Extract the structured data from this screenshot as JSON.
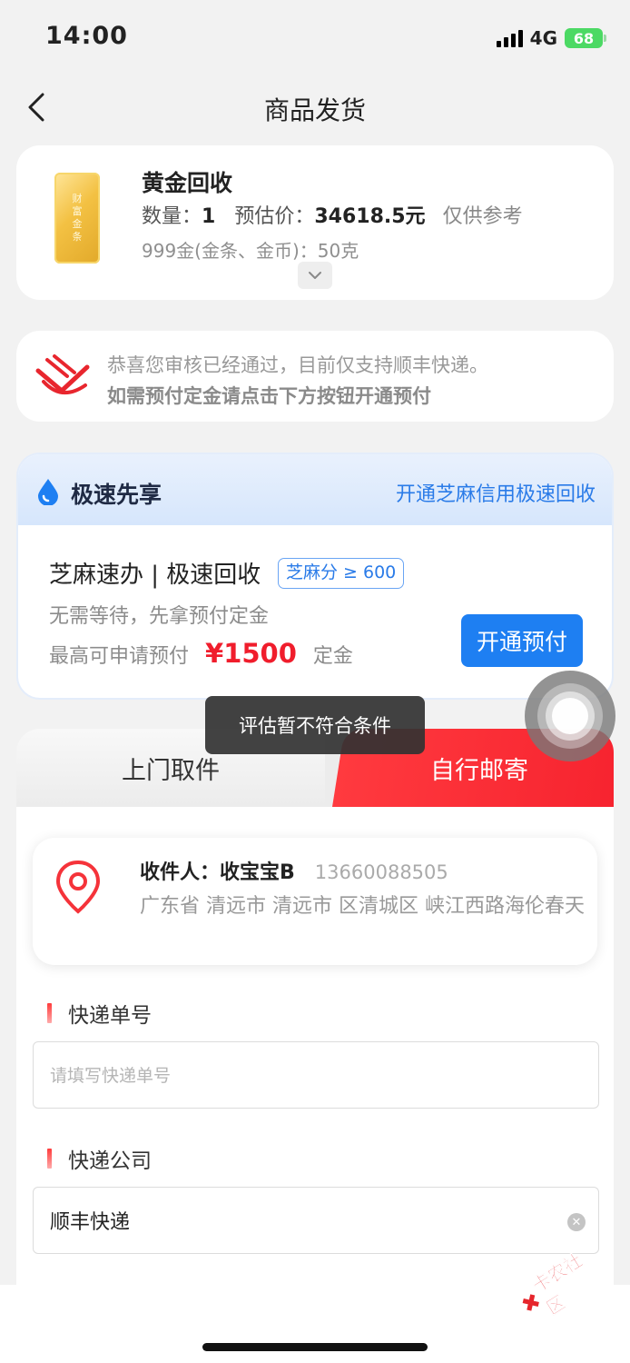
{
  "status_bar": {
    "time": "14:00",
    "network": "4G",
    "battery": "68"
  },
  "nav": {
    "title": "商品发货"
  },
  "product": {
    "title": "黄金回收",
    "quantity_label": "数量：",
    "quantity": "1",
    "price_label": "预估价：",
    "price": "34618.5元",
    "price_note": "仅供参考",
    "spec": "999金(金条、金币)：50克",
    "image_text": [
      "财",
      "富",
      "金",
      "条"
    ]
  },
  "notice": {
    "line1": "恭喜您审核已经通过，目前仅支持顺丰快递。",
    "line2": "如需预付定金请点击下方按钮开通预付"
  },
  "speed": {
    "title": "极速先享",
    "link": "开通芝麻信用极速回收",
    "product_title": "芝麻速办 | 极速回收",
    "badge": "芝麻分 ≥ 600",
    "subtitle": "无需等待，先拿预付定金",
    "max_prefix": "最高可申请预付",
    "max_amount": "¥1500",
    "max_suffix": "定金",
    "button": "开通预付"
  },
  "toast": {
    "text": "评估暂不符合条件"
  },
  "tabs": {
    "pickup": "上门取件",
    "mail": "自行邮寄"
  },
  "address": {
    "recipient_label": "收件人：",
    "recipient_name": "收宝宝B",
    "phone": "13660088505",
    "full": "广东省 清远市 清远市 区清城区 峡江西路海伦春天"
  },
  "form": {
    "tracking_label": "快递单号",
    "tracking_placeholder": "请填写快递单号",
    "company_label": "快递公司",
    "company_value": "顺丰快递"
  },
  "watermark": {
    "text": "卡农社区"
  },
  "colors": {
    "accent_red": "#f5333a",
    "accent_blue": "#1e7ff2",
    "price_red": "#f01d2c"
  }
}
